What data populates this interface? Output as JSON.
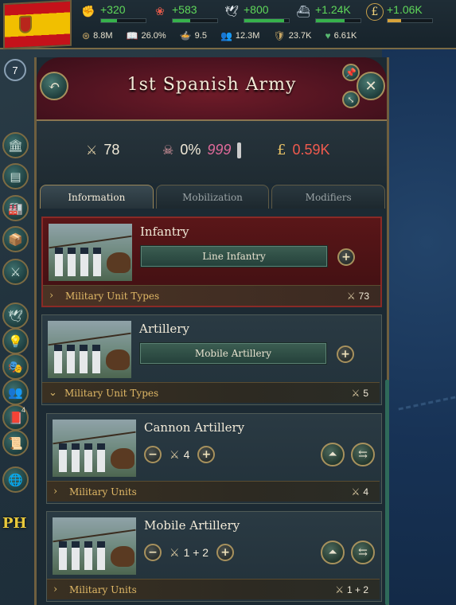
{
  "topbar": {
    "level": "7",
    "resources": [
      {
        "icon": "authority-icon",
        "value": "+320",
        "fill": 0.35
      },
      {
        "icon": "influence-icon",
        "value": "+583",
        "fill": 0.4
      },
      {
        "icon": "dove-icon",
        "value": "+800",
        "fill": 0.9
      },
      {
        "icon": "ship-icon",
        "value": "+1.24K",
        "fill": 0.65
      },
      {
        "icon": "pound-icon",
        "value": "+1.06K",
        "fill": 0.3
      }
    ],
    "stats": [
      {
        "icon": "gdp-icon",
        "value": "8.8M"
      },
      {
        "icon": "literacy-icon",
        "value": "26.0%"
      },
      {
        "icon": "food-icon",
        "value": "9.5"
      },
      {
        "icon": "population-icon",
        "value": "12.3M"
      },
      {
        "icon": "army-icon",
        "value": "23.7K"
      },
      {
        "icon": "heart-icon",
        "value": "6.61K"
      }
    ]
  },
  "sidebar": {
    "buttons": [
      "government-icon",
      "economy-icon",
      "industry-icon",
      "trade-icon",
      "military-icon",
      "diplomacy-icon",
      "technology-icon",
      "politics-icon",
      "population-icon",
      "journal-icon",
      "ledger-icon",
      "world-icon"
    ],
    "badge": "4",
    "ph_label": "PH"
  },
  "army": {
    "title": "1st Spanish Army",
    "summary": {
      "manpower": "78",
      "casualty_rate": "0%",
      "morale": "999",
      "upkeep": "0.59K"
    },
    "tabs": [
      "Information",
      "Mobilization",
      "Modifiers"
    ],
    "active_tab": 0
  },
  "cards": [
    {
      "title": "Infantry",
      "type_button": "Line Infantry",
      "footer_label": "Military Unit Types",
      "footer_count": "73",
      "expanded": false
    },
    {
      "title": "Artillery",
      "type_button": "Mobile Artillery",
      "footer_label": "Military Unit Types",
      "footer_count": "5",
      "expanded": true
    },
    {
      "title": "Cannon Artillery",
      "stepper_value": "4",
      "footer_label": "Military Units",
      "footer_count": "4"
    },
    {
      "title": "Mobile Artillery",
      "stepper_value": "1 + 2",
      "footer_label": "Military Units",
      "footer_count": "1 + 2"
    }
  ]
}
